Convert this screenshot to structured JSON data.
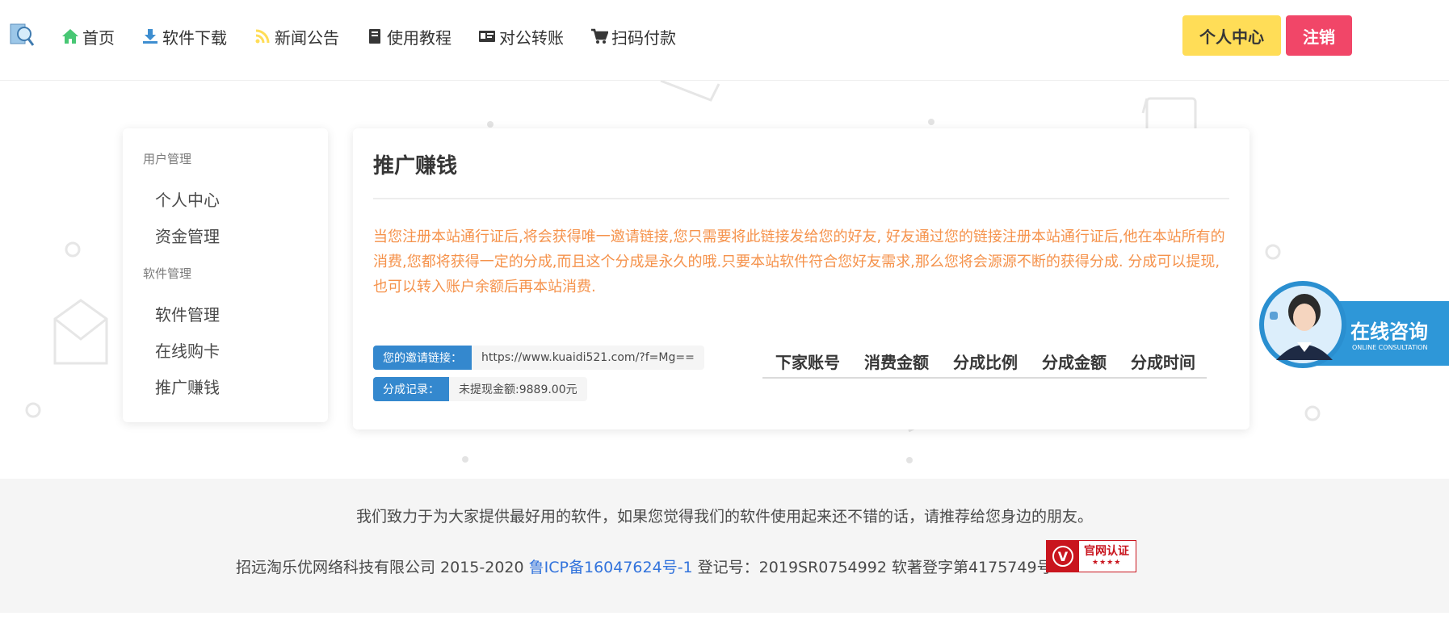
{
  "nav": {
    "items": [
      {
        "label": "首页",
        "icon": "home-icon",
        "color": "#48c774"
      },
      {
        "label": "软件下载",
        "icon": "download-icon",
        "color": "#3e8ed0"
      },
      {
        "label": "新闻公告",
        "icon": "rss-icon",
        "color": "#ffdd57"
      },
      {
        "label": "使用教程",
        "icon": "book-icon",
        "color": "#363636"
      },
      {
        "label": "对公转账",
        "icon": "id-card-icon",
        "color": "#363636"
      },
      {
        "label": "扫码付款",
        "icon": "cart-icon",
        "color": "#363636"
      }
    ],
    "user_center": "个人中心",
    "logout": "注销"
  },
  "sidebar": {
    "groups": [
      {
        "label": "用户管理",
        "items": [
          "个人中心",
          "资金管理"
        ]
      },
      {
        "label": "软件管理",
        "items": [
          "软件管理",
          "在线购卡",
          "推广赚钱"
        ]
      }
    ]
  },
  "main": {
    "title": "推广赚钱",
    "description": "当您注册本站通行证后,将会获得唯一邀请链接,您只需要将此链接发给您的好友, 好友通过您的链接注册本站通行证后,他在本站所有的消费,您都将获得一定的分成,而且这个分成是永久的哦.只要本站软件符合您好友需求,那么您将会源源不断的获得分成. 分成可以提现,也可以转入账户余额后再本站消费.",
    "invite_label": "您的邀请链接：",
    "invite_link": "https://www.kuaidi521.com/?f=Mg==",
    "record_label": "分成记录：",
    "record_value": "未提现金额:9889.00元",
    "table_headers": [
      "下家账号",
      "消费金额",
      "分成比例",
      "分成金额",
      "分成时间"
    ]
  },
  "consult": {
    "title": "在线咨询",
    "subtitle": "ONLINE CONSULTATION"
  },
  "footer": {
    "slogan": "我们致力于为大家提供最好用的软件，如果您觉得我们的软件使用起来还不错的话，请推荐给您身边的朋友。",
    "company": "招远淘乐优网络科技有限公司 2015-2020 ",
    "icp": "鲁ICP备16047624号-1",
    "reg": "  登记号：2019SR0754992 软著登字第4175749号",
    "badge": "官网认证",
    "badge_stars": "★★★★",
    "badge_mark": "V"
  },
  "colors": {
    "accent_blue": "#3488ce",
    "warning_yellow": "#ffdd57",
    "danger_red": "#f14668",
    "orange_text": "#f5924b"
  }
}
